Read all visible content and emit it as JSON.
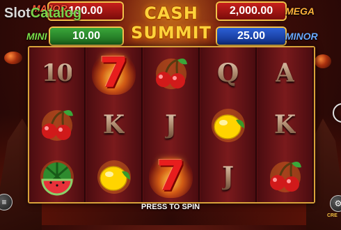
{
  "watermark": {
    "prefix": "Slot",
    "suffix": "Catalog"
  },
  "logo": {
    "line1": "CASH",
    "line2": "SUMMIT"
  },
  "jackpots": {
    "major": {
      "label": "MAJOR",
      "value": "100.00",
      "color": "#c7201c"
    },
    "mega": {
      "label": "MEGA",
      "value": "2,000.00",
      "color": "#c7201c"
    },
    "mini": {
      "label": "MINI",
      "value": "10.00",
      "color": "#3aa63a"
    },
    "minor": {
      "label": "MINOR",
      "value": "25.00",
      "color": "#2b5fd6"
    }
  },
  "reels": [
    [
      "10",
      "cherry-icon",
      "watermelon-icon"
    ],
    [
      "seven-icon",
      "K",
      "lemon-icon"
    ],
    [
      "cherry-icon",
      "J",
      "seven-icon"
    ],
    [
      "Q",
      "lemon-icon",
      "J"
    ],
    [
      "A",
      "K",
      "cherry-icon"
    ]
  ],
  "controls": {
    "spin_label": "PRESS TO SPIN",
    "credit_label": "CRE"
  }
}
